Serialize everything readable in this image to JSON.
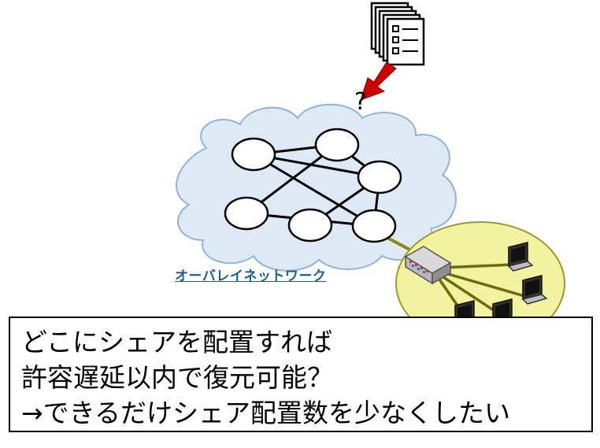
{
  "diagram": {
    "question_mark": "?",
    "network_label": "オーバレイネットワーク",
    "text_box": {
      "line1": "どこにシェアを配置すれば",
      "line2": "許容遅延以内で復元可能？",
      "line3": "→できるだけシェア配置数を少なくしたい"
    }
  },
  "colors": {
    "cloud_fill": "#dde9f5",
    "cloud_stroke": "#8fb4da",
    "node_fill": "#ffffff",
    "edge": "#000000",
    "arrow": "#cc0000",
    "lan_fill": "#f2f2a0",
    "lan_stroke": "#9a9a30",
    "lan_link": "#6b6b10",
    "label": "#1f5d8c"
  },
  "icons": [
    "document-stack-icon",
    "down-arrow-icon",
    "switch-icon",
    "laptop-icon"
  ]
}
